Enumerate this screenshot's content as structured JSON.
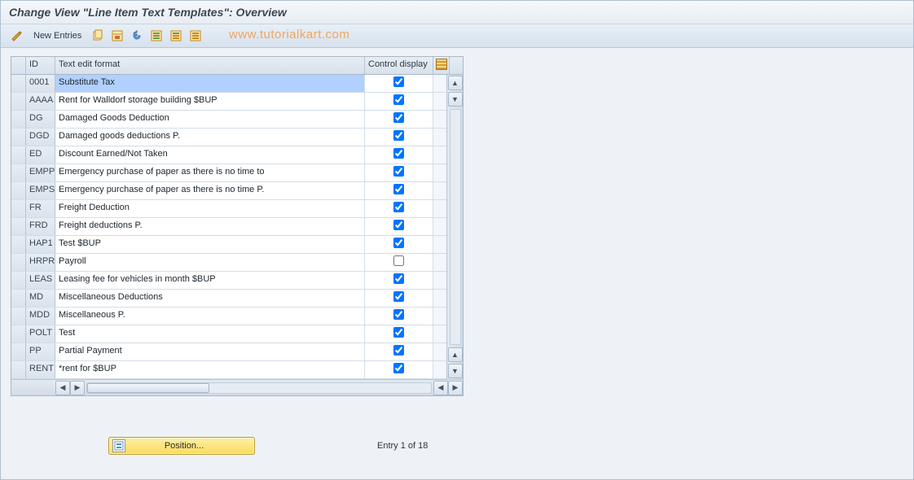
{
  "title": "Change View \"Line Item Text Templates\": Overview",
  "toolbar": {
    "new_entries": "New Entries"
  },
  "watermark": "www.tutorialkart.com",
  "columns": {
    "id": "ID",
    "text": "Text edit format",
    "ctrl": "Control display"
  },
  "rows": [
    {
      "id": "0001",
      "text": "Substitute Tax",
      "checked": true,
      "selected": true
    },
    {
      "id": "AAAA",
      "text": "Rent for Walldorf storage building $BUP",
      "checked": true
    },
    {
      "id": "DG",
      "text": "Damaged Goods Deduction",
      "checked": true
    },
    {
      "id": "DGD",
      "text": "Damaged goods deductions P.",
      "checked": true
    },
    {
      "id": "ED",
      "text": "Discount Earned/Not Taken",
      "checked": true
    },
    {
      "id": "EMPP",
      "text": "Emergency purchase of paper as there is no time to",
      "checked": true
    },
    {
      "id": "EMPS",
      "text": "Emergency purchase of paper as there is no time P.",
      "checked": true
    },
    {
      "id": "FR",
      "text": "Freight Deduction",
      "checked": true
    },
    {
      "id": "FRD",
      "text": "Freight deductions P.",
      "checked": true
    },
    {
      "id": "HAP1",
      "text": "Test $BUP",
      "checked": true
    },
    {
      "id": "HRPR",
      "text": "Payroll",
      "checked": false
    },
    {
      "id": "LEAS",
      "text": "Leasing fee for vehicles in month $BUP",
      "checked": true
    },
    {
      "id": "MD",
      "text": "Miscellaneous Deductions",
      "checked": true
    },
    {
      "id": "MDD",
      "text": "Miscellaneous P.",
      "checked": true
    },
    {
      "id": "POLT",
      "text": "Test",
      "checked": true
    },
    {
      "id": "PP",
      "text": "Partial Payment",
      "checked": true
    },
    {
      "id": "RENT",
      "text": "*rent for $BUP",
      "checked": true
    }
  ],
  "footer": {
    "position_label": "Position...",
    "entry_text": "Entry 1 of 18"
  }
}
